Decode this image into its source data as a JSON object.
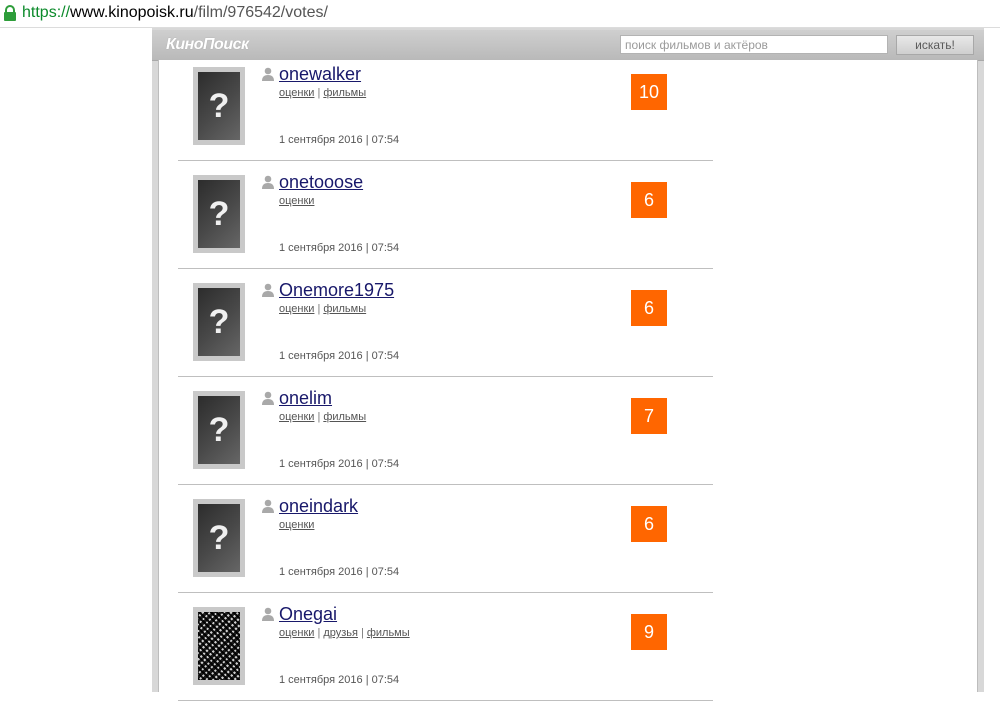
{
  "browser": {
    "url_scheme": "https://",
    "url_host": "www.kinopoisk.ru",
    "url_path": "/film/976542/votes/"
  },
  "header": {
    "logo": "КиноПоиск",
    "search_placeholder": "поиск фильмов и актёров",
    "search_button": "искать!"
  },
  "colors": {
    "score_bg": "#ff6600",
    "username": "#18186a"
  },
  "votes": [
    {
      "username": "onewalker",
      "links": [
        "оценки",
        "фильмы"
      ],
      "date": "1 сентября 2016 | 07:54",
      "score": "10",
      "avatar": "placeholder"
    },
    {
      "username": "onetooose",
      "links": [
        "оценки"
      ],
      "date": "1 сентября 2016 | 07:54",
      "score": "6",
      "avatar": "placeholder"
    },
    {
      "username": "Onemore1975",
      "links": [
        "оценки",
        "фильмы"
      ],
      "date": "1 сентября 2016 | 07:54",
      "score": "6",
      "avatar": "placeholder"
    },
    {
      "username": "onelim",
      "links": [
        "оценки",
        "фильмы"
      ],
      "date": "1 сентября 2016 | 07:54",
      "score": "7",
      "avatar": "placeholder"
    },
    {
      "username": "oneindark",
      "links": [
        "оценки"
      ],
      "date": "1 сентября 2016 | 07:54",
      "score": "6",
      "avatar": "placeholder"
    },
    {
      "username": "Onegai",
      "links": [
        "оценки",
        "друзья",
        "фильмы"
      ],
      "date": "1 сентября 2016 | 07:54",
      "score": "9",
      "avatar": "photo"
    }
  ]
}
